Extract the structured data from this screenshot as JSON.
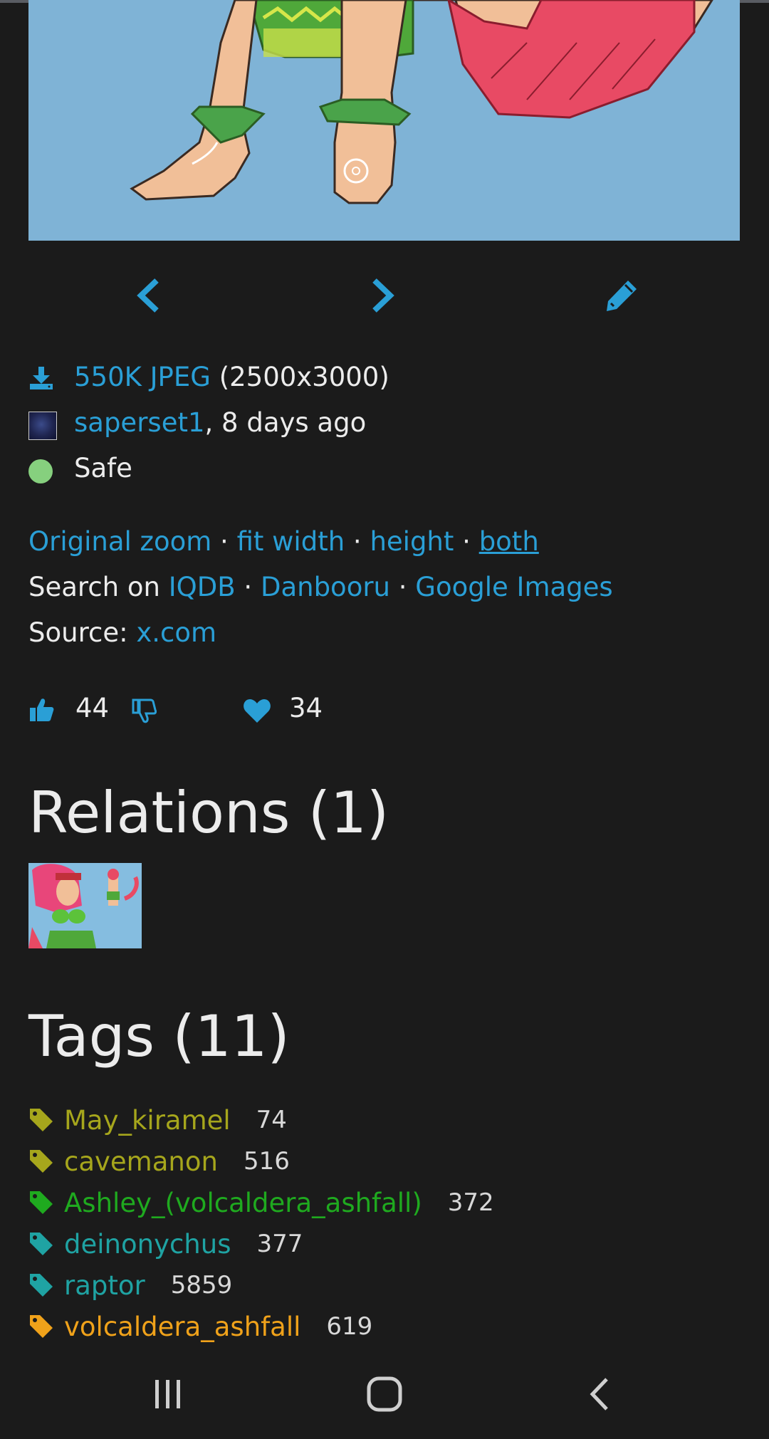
{
  "file": {
    "size_type": "550K JPEG",
    "dimensions": "(2500x3000)"
  },
  "uploader": {
    "name": "saperset1",
    "time": ", 8 days ago"
  },
  "rating": {
    "label": "Safe",
    "color": "#86d07e"
  },
  "zoom": {
    "original": "Original zoom",
    "sep": " · ",
    "fit_width": "fit width",
    "height": "height",
    "both": "both"
  },
  "search": {
    "prefix": "Search on ",
    "iqdb": "IQDB",
    "danbooru": "Danbooru",
    "google": "Google Images"
  },
  "source": {
    "label": "Source: ",
    "link": "x.com"
  },
  "votes": {
    "up_count": "44",
    "fav_count": "34"
  },
  "relations": {
    "heading": "Relations (1)"
  },
  "tags": {
    "heading": "Tags (11)",
    "items": [
      {
        "name": "May_kiramel",
        "count": "74",
        "color": "#a6a61c"
      },
      {
        "name": "cavemanon",
        "count": "516",
        "color": "#a6a61c"
      },
      {
        "name": "Ashley_(volcaldera_ashfall)",
        "count": "372",
        "color": "#1faa1f"
      },
      {
        "name": "deinonychus",
        "count": "377",
        "color": "#1fa3a3"
      },
      {
        "name": "raptor",
        "count": "5859",
        "color": "#1fa3a3"
      },
      {
        "name": "volcaldera_ashfall",
        "count": "619",
        "color": "#f0a21a"
      }
    ]
  },
  "colors": {
    "link": "#2a9fd6",
    "background": "#1b1b1b",
    "text": "#ececec"
  },
  "icons": {
    "prev": "chevron-left-icon",
    "next": "chevron-right-icon",
    "edit": "pencil-icon",
    "download": "download-icon",
    "rating": "circle-icon",
    "upvote": "thumbs-up-icon",
    "downvote": "thumbs-down-icon",
    "favorite": "heart-icon",
    "tag": "tag-icon",
    "recents": "recent-apps-icon",
    "home": "home-icon",
    "back": "back-icon"
  }
}
